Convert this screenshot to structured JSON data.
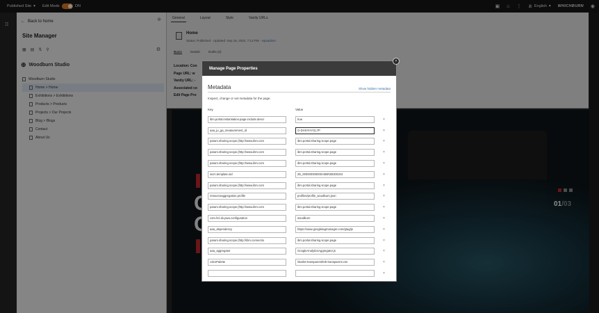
{
  "topbar": {
    "site_switcher": "Published Site",
    "edit_mode_label": "Edit Mode",
    "edit_mode_state": "ON",
    "language": "English",
    "brand": "WHICHBURN"
  },
  "sidebar": {
    "back_label": "Back to home",
    "title": "Site Manager",
    "site_name": "Woodburn Studio",
    "tree": [
      {
        "label": "Woodburn Studio"
      },
      {
        "label": "Home > Home"
      },
      {
        "label": "Exhibitions > Exhibitions"
      },
      {
        "label": "Products > Products"
      },
      {
        "label": "Projects > Our Projects"
      },
      {
        "label": "Blog > Blogs"
      },
      {
        "label": "Contact"
      },
      {
        "label": "About Us"
      }
    ]
  },
  "properties": {
    "tabs": [
      "General",
      "Layout",
      "Style",
      "Vanity URLs"
    ],
    "page_title": "Home",
    "status": "Status: Published  ·  Updated: Sep 16, 2022, 7:13 PM  ·",
    "updated_by": "wpsadmin",
    "subtabs": [
      "Basic",
      "Details",
      "Drafts (0)"
    ],
    "details": [
      "Location: Con",
      "Page URL: w",
      "Vanity URL: -",
      "Associated co",
      "Edit Page Pro"
    ]
  },
  "hero": {
    "big_letter_1": "C",
    "big_letter_2": "C",
    "pager_current": "01",
    "pager_sep": "/",
    "pager_total": "03"
  },
  "modal": {
    "title": "Manage Page Properties",
    "section_title": "Metadata",
    "show_hidden_link": "Show hidden metadata",
    "description": "Inspect, change or set metadata for the page.",
    "key_header": "Key",
    "value_header": "Value",
    "remove_glyph": "×",
    "rows": [
      {
        "key": "ibm.portal.instantiation.page.include.descr",
        "value": "true"
      },
      {
        "key": "aaa_ju_ga_measurement_id",
        "value": "G-DHSYHYGL7P"
      },
      {
        "key": "param.sharing.scope.{http://www.ibm.com",
        "value": "ibm.portal.sharing.scope.page"
      },
      {
        "key": "param.sharing.scope.{http://www.ibm.com",
        "value": "ibm.portal.sharing.scope.page"
      },
      {
        "key": "param.sharing.scope.{http://www.ibm.com",
        "value": "ibm.portal.sharing.scope.page"
      },
      {
        "key": "wcm.template.oid",
        "value": "Z6_000000000000A0BR2B300204"
      },
      {
        "key": "param.sharing.scope.{http://www.ibm.com",
        "value": "ibm.portal.sharing.scope.page"
      },
      {
        "key": "resourceaggregation.profile",
        "value": "profiles/profile_woodburn.json"
      },
      {
        "key": "param.sharing.scope.{http://www.ibm.com",
        "value": "ibm.portal.sharing.scope.page"
      },
      {
        "key": "com.hcl.dx.pwa.configuration",
        "value": "woodburn"
      },
      {
        "key": "aaa_dependency",
        "value": "https://www.googletagmanager.com/gtag/js"
      },
      {
        "key": "param.sharing.scope.{http://ibm.connectio",
        "value": "ibm.portal.sharing.scope.page"
      },
      {
        "key": "aaa_aggregator",
        "value": "GoogleAnalyticsAggregator.js"
      },
      {
        "key": "colorPalette",
        "value": "/starlet-transparent/teb-transparent.css"
      },
      {
        "key": "",
        "value": ""
      }
    ]
  }
}
